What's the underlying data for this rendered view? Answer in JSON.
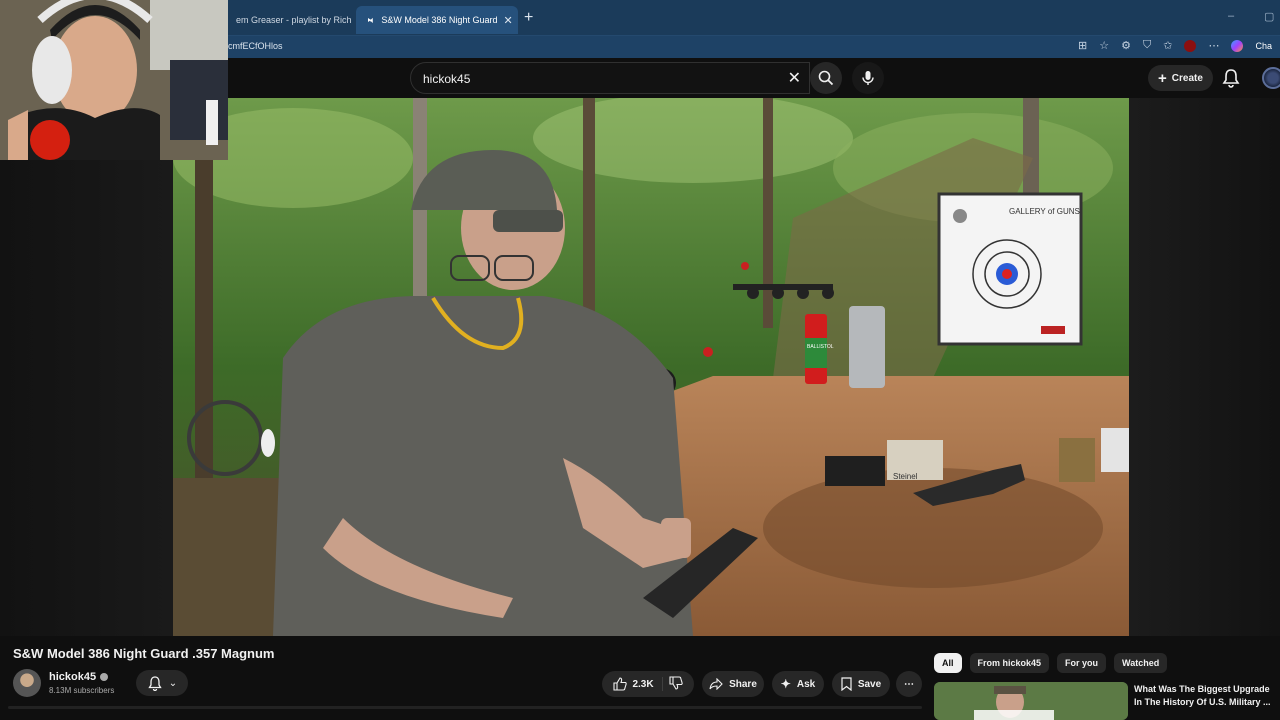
{
  "browser": {
    "tabs": [
      {
        "label": "em Greaser - playlist by Rich",
        "active": false
      },
      {
        "label": "S&W Model 386 Night Guard",
        "active": true
      }
    ],
    "url_fragment": "cmfECfOHlos",
    "copilot_label": "Cha"
  },
  "masthead": {
    "search_value": "hickok45",
    "create_label": "Create"
  },
  "video": {
    "title": "S&W Model 386 Night Guard .357 Magnum",
    "target_text_top": "GALLERY of GUNS",
    "ammo_box_label": "Steinel",
    "spray_can_label": "BALLISTOL"
  },
  "channel": {
    "name": "hickok45",
    "subscribers": "8.13M subscribers"
  },
  "actions": {
    "likes": "2.3K",
    "share": "Share",
    "ask": "Ask",
    "save": "Save"
  },
  "chips": [
    "All",
    "From hickok45",
    "For you",
    "Watched"
  ],
  "recommendation": {
    "title": "What Was The Biggest Upgrade In The History Of U.S. Military ..."
  },
  "colors": {
    "browser_tab_bg": "#1b3b5a",
    "youtube_bg": "#0f0f0f",
    "pill_bg": "#272727",
    "chip_selected_bg": "#f1f1f1",
    "youtube_red": "#ff0033"
  }
}
